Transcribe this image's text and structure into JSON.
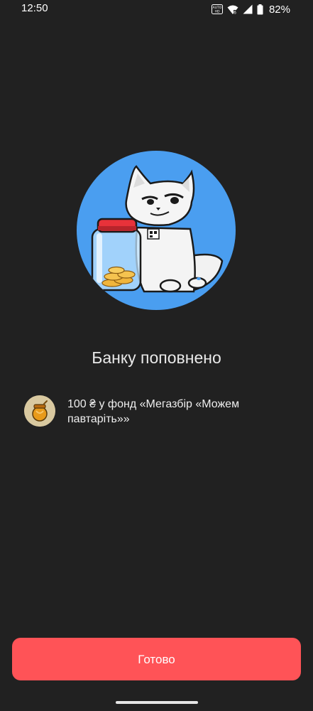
{
  "status_bar": {
    "time": "12:50",
    "battery_percent": "82%",
    "icons": [
      "auto-hd-icon",
      "wifi-icon",
      "signal-icon",
      "battery-icon"
    ]
  },
  "illustration": {
    "icon": "cat-with-coin-jar-illustration",
    "circle_color": "#4a9ef0"
  },
  "title": "Банку поповнено",
  "fund": {
    "icon": "honey-pot-icon",
    "text": "100 ₴ у фонд «Мегазбір «Можем павтаріть»»"
  },
  "done_button": {
    "label": "Готово",
    "color": "#ff5357"
  }
}
